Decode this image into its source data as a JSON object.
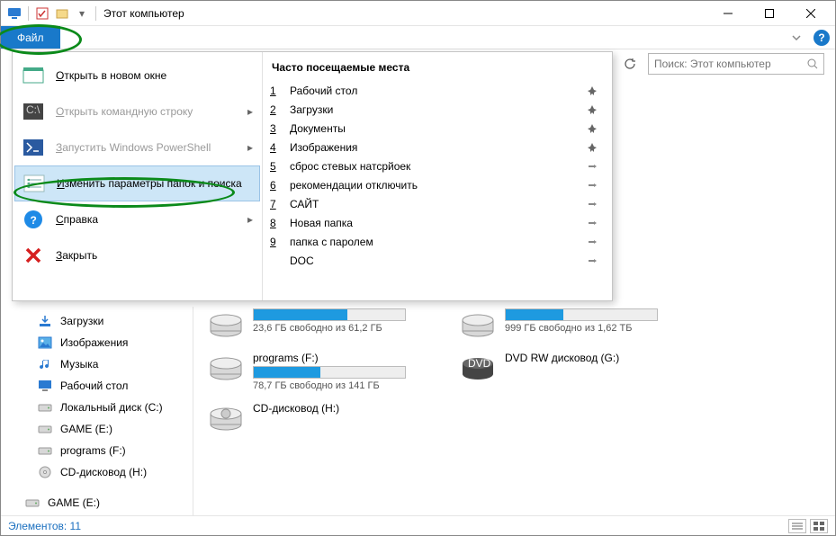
{
  "window": {
    "title": "Этот компьютер"
  },
  "ribbon": {
    "file_tab": "Файл"
  },
  "search": {
    "placeholder": "Поиск: Этот компьютер"
  },
  "file_menu": {
    "left": [
      {
        "label": "Открыть в новом окне",
        "disabled": false,
        "arrow": false
      },
      {
        "label": "Открыть командную строку",
        "disabled": true,
        "arrow": true
      },
      {
        "label": "Запустить Windows PowerShell",
        "disabled": true,
        "arrow": true
      },
      {
        "label": "Изменить параметры папок и поиска",
        "disabled": false,
        "arrow": false,
        "hover": true
      },
      {
        "label": "Справка",
        "disabled": false,
        "arrow": true
      },
      {
        "label": "Закрыть",
        "disabled": false,
        "arrow": false
      }
    ],
    "right_header": "Часто посещаемые места",
    "right_items": [
      {
        "n": "1",
        "name": "Рабочий стол",
        "pinned": true
      },
      {
        "n": "2",
        "name": "Загрузки",
        "pinned": true
      },
      {
        "n": "3",
        "name": "Документы",
        "pinned": true
      },
      {
        "n": "4",
        "name": "Изображения",
        "pinned": true
      },
      {
        "n": "5",
        "name": "сброс стевых натсрйоек",
        "pinned": false
      },
      {
        "n": "6",
        "name": "рекомендации отключить",
        "pinned": false
      },
      {
        "n": "7",
        "name": "САЙТ",
        "pinned": false
      },
      {
        "n": "8",
        "name": "Новая папка",
        "pinned": false
      },
      {
        "n": "9",
        "name": "папка с паролем",
        "pinned": false
      },
      {
        "n": "",
        "name": "DOC",
        "pinned": false
      }
    ]
  },
  "sidebar": [
    {
      "label": "Загрузки",
      "icon": "download"
    },
    {
      "label": "Изображения",
      "icon": "image"
    },
    {
      "label": "Музыка",
      "icon": "music"
    },
    {
      "label": "Рабочий стол",
      "icon": "desktop"
    },
    {
      "label": "Локальный диск (C:)",
      "icon": "disk"
    },
    {
      "label": "GAME (E:)",
      "icon": "disk"
    },
    {
      "label": "programs (F:)",
      "icon": "disk"
    },
    {
      "label": "CD-дисковод (H:)",
      "icon": "cd"
    },
    {
      "label": "GAME (E:)",
      "icon": "disk",
      "group": true
    }
  ],
  "drives": [
    {
      "name": "",
      "free": "23,6 ГБ свободно из 61,2 ГБ",
      "fill": 62
    },
    {
      "name": "",
      "free": "999 ГБ свободно из 1,62 ТБ",
      "fill": 38
    },
    {
      "name": "programs (F:)",
      "free": "78,7 ГБ свободно из 141 ГБ",
      "fill": 44
    },
    {
      "name": "DVD RW дисковод (G:)",
      "free": "",
      "fill": -1,
      "dvd": true
    },
    {
      "name": "CD-дисковод (H:)",
      "free": "",
      "fill": -1,
      "cd": true
    }
  ],
  "status": {
    "text": "Элементов: 11"
  }
}
